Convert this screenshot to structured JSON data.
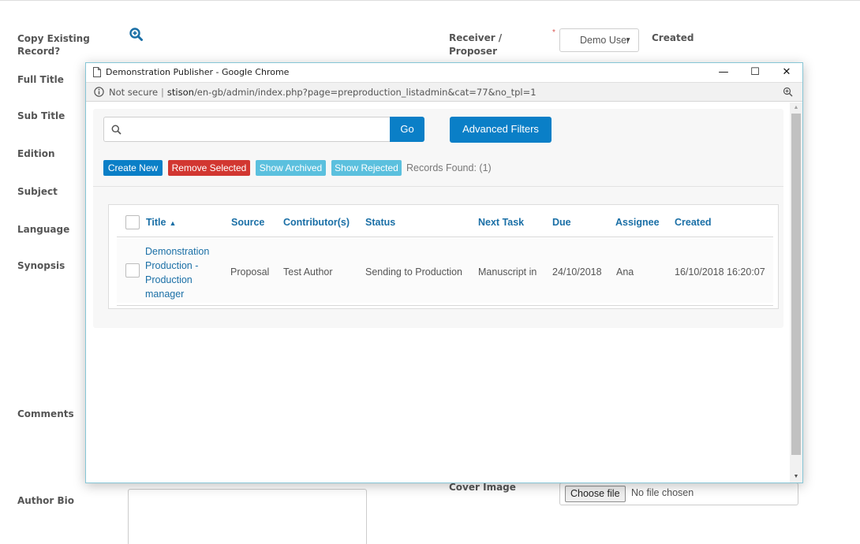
{
  "form": {
    "labels": {
      "copy_existing": "Copy Existing Record?",
      "full_title": "Full Title",
      "sub_title": "Sub Title",
      "edition": "Edition",
      "subject": "Subject",
      "language": "Language",
      "synopsis": "Synopsis",
      "comments": "Comments",
      "author_bio": "Author Bio"
    },
    "receiver_label": "Receiver / Proposer",
    "receiver_value": "Demo User",
    "required_mark": "*",
    "created_label": "Created",
    "cover_image_label": "Cover Image",
    "file_button": "Choose file",
    "file_status": "No file chosen"
  },
  "popup": {
    "window_title": "Demonstration Publisher - Google Chrome",
    "security_label": "Not secure",
    "separator": "|",
    "url_host": "stison",
    "url_path": "/en-gb/admin/index.php?page=preproduction_listadmin&cat=77&no_tpl=1",
    "controls": {
      "minimize": "—",
      "maximize": "☐",
      "close": "✕"
    }
  },
  "toolbar": {
    "search_placeholder": "",
    "search_value": "",
    "go_label": "Go",
    "advanced_filters_label": "Advanced Filters",
    "create_new_label": "Create New",
    "remove_selected_label": "Remove Selected",
    "show_archived_label": "Show Archived",
    "show_rejected_label": "Show Rejected",
    "records_found": "Records Found: (1)"
  },
  "table": {
    "columns": {
      "title": "Title",
      "source": "Source",
      "contributors": "Contributor(s)",
      "status": "Status",
      "next_task": "Next Task",
      "due": "Due",
      "assignee": "Assignee",
      "created": "Created"
    },
    "sort_indicator": "▲",
    "rows": [
      {
        "title_lines": [
          "Demonstration",
          "Production -",
          "Production",
          "manager"
        ],
        "source": "Proposal",
        "contributors": "Test Author",
        "status": "Sending to Production",
        "next_task": "Manuscript in",
        "due": "24/10/2018",
        "assignee": "Ana",
        "created": "16/10/2018 16:20:07"
      }
    ]
  },
  "colors": {
    "primary": "#0a7fc7",
    "danger": "#d23731",
    "info": "#5bc0de",
    "link": "#1a6fa6"
  }
}
